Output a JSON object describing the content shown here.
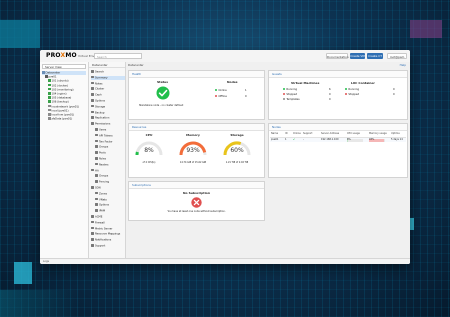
{
  "topbar": {
    "logo_prefix": "PRO",
    "logo_x": "X",
    "logo_suffix": "MO",
    "version": "Virtual Environment 8.x",
    "search_placeholder": "Search",
    "documentation_label": "Documentation",
    "create_vm_label": "Create VM",
    "create_ct_label": "Create CT",
    "user_label": "root@pam"
  },
  "left_panel": {
    "view_selector": "Server View",
    "tree": [
      {
        "label": "Datacenter",
        "icon": "datacenter-icon",
        "level": 0,
        "selected": true
      },
      {
        "label": "pve01",
        "icon": "node-icon",
        "level": 1
      },
      {
        "label": "101 (ubuntu)",
        "icon": "vm-icon",
        "level": 2
      },
      {
        "label": "102 (docker)",
        "icon": "vm-icon",
        "level": 2
      },
      {
        "label": "103 (monitoring)",
        "icon": "vm-icon",
        "level": 2
      },
      {
        "label": "104 (nginx)",
        "icon": "vm-icon",
        "level": 2
      },
      {
        "label": "105 (database)",
        "icon": "vm-icon",
        "level": 2
      },
      {
        "label": "106 (backup)",
        "icon": "vm-icon",
        "level": 2
      },
      {
        "label": "localnetwork (pve01)",
        "icon": "storage-icon",
        "level": 2
      },
      {
        "label": "local (pve01)",
        "icon": "storage-icon",
        "level": 2
      },
      {
        "label": "local-lvm (pve01)",
        "icon": "storage-icon",
        "level": 2
      },
      {
        "label": "zfsData (pve01)",
        "icon": "storage-icon",
        "level": 2
      }
    ]
  },
  "menu": {
    "header": "Datacenter",
    "items": [
      {
        "label": "Search",
        "active": false
      },
      {
        "label": "Summary",
        "active": true
      },
      {
        "label": "Notes",
        "active": false
      },
      {
        "label": "Cluster",
        "active": false
      },
      {
        "label": "Ceph",
        "active": false
      },
      {
        "label": "Options",
        "active": false
      },
      {
        "label": "Storage",
        "active": false
      },
      {
        "label": "Backup",
        "active": false
      },
      {
        "label": "Replication",
        "active": false
      },
      {
        "label": "Permissions",
        "active": false
      },
      {
        "label": "Users",
        "active": false
      },
      {
        "label": "API Tokens",
        "active": false
      },
      {
        "label": "Two Factor",
        "active": false
      },
      {
        "label": "Groups",
        "active": false
      },
      {
        "label": "Pools",
        "active": false
      },
      {
        "label": "Roles",
        "active": false
      },
      {
        "label": "Realms",
        "active": false
      },
      {
        "label": "HA",
        "active": false
      },
      {
        "label": "Groups",
        "active": false
      },
      {
        "label": "Fencing",
        "active": false
      },
      {
        "label": "SDN",
        "active": false
      },
      {
        "label": "Zones",
        "active": false
      },
      {
        "label": "VNets",
        "active": false
      },
      {
        "label": "Options",
        "active": false
      },
      {
        "label": "IPAM",
        "active": false
      },
      {
        "label": "ACME",
        "active": false
      },
      {
        "label": "Firewall",
        "active": false
      },
      {
        "label": "Metric Server",
        "active": false
      },
      {
        "label": "Resource Mappings",
        "active": false
      },
      {
        "label": "Notifications",
        "active": false
      },
      {
        "label": "Support",
        "active": false
      }
    ]
  },
  "content": {
    "breadcrumb": "Datacenter",
    "help_label": "Help"
  },
  "health": {
    "title": "Health",
    "status_label": "Status",
    "status_text": "Standalone node - no cluster defined",
    "nodes_label": "Nodes",
    "online_label": "Online",
    "online_count": "1",
    "offline_label": "Offline",
    "offline_count": "0",
    "ok_color": "#21bf4b",
    "err_color": "#e05050"
  },
  "guests": {
    "title": "Guests",
    "vm_title": "Virtual Machines",
    "lxc_title": "LXC Container",
    "vm_rows": [
      {
        "label": "Running",
        "value": "6"
      },
      {
        "label": "Stopped",
        "value": "0"
      },
      {
        "label": "Templates",
        "value": "0"
      }
    ],
    "lxc_rows": [
      {
        "label": "Running",
        "value": "0"
      },
      {
        "label": "Stopped",
        "value": "0"
      }
    ]
  },
  "resources": {
    "title": "Resources",
    "gauges": [
      {
        "label": "CPU",
        "percent": 8,
        "display": "8%",
        "detail": "of 4 CPU(s)",
        "color": "#21bf4b"
      },
      {
        "label": "Memory",
        "percent": 93,
        "display": "93%",
        "detail": "14.74 GiB of 15.62 GiB",
        "color": "#f36d3a"
      },
      {
        "label": "Storage",
        "percent": 60,
        "display": "60%",
        "detail": "1.21 TiB of 2.02 TiB",
        "color": "#e9c41b"
      }
    ]
  },
  "nodes": {
    "title": "Nodes",
    "columns": [
      "Name",
      "ID",
      "Online",
      "Support",
      "Server Address",
      "CPU usage",
      "Memory usage",
      "Uptime"
    ],
    "rows": [
      {
        "name": "pve01",
        "id": "1",
        "online": "✔",
        "support": "-",
        "address": "192.168.1.100",
        "cpu": "8%",
        "memory": "93%",
        "uptime": "5 days 14"
      }
    ]
  },
  "subscriptions": {
    "title": "Subscriptions",
    "heading": "No Subscription",
    "text": "You have at least one node without subscription."
  },
  "statusbar": {
    "label": "Logs"
  }
}
